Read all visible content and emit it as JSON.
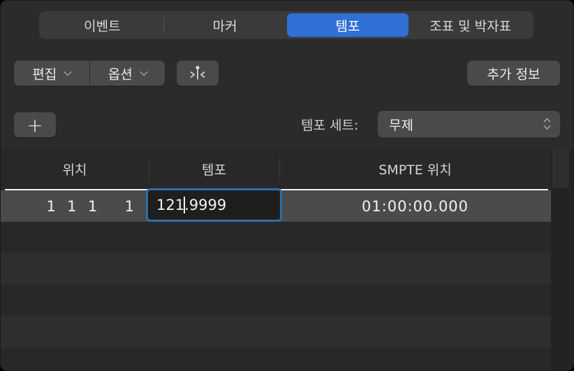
{
  "tabs": [
    {
      "label": "이벤트",
      "active": false
    },
    {
      "label": "마커",
      "active": false
    },
    {
      "label": "템포",
      "active": true
    },
    {
      "label": "조표 및 박자표",
      "active": false
    }
  ],
  "toolbar": {
    "edit_label": "편집",
    "options_label": "옵션",
    "more_info_label": "추가 정보"
  },
  "tempo_set": {
    "add_label": "+",
    "label": "템포 세트:",
    "selected": "무제"
  },
  "table": {
    "columns": [
      "위치",
      "템포",
      "SMPTE 위치"
    ],
    "rows": [
      {
        "position": "1  1  1     1",
        "tempo_before_caret": "121",
        "tempo_after_caret": ".9999",
        "smpte": "01:00:00.000"
      }
    ]
  },
  "colors": {
    "accent": "#2f6fd6",
    "focus_ring": "#2f6fa8",
    "background": "#2b2b2b"
  }
}
